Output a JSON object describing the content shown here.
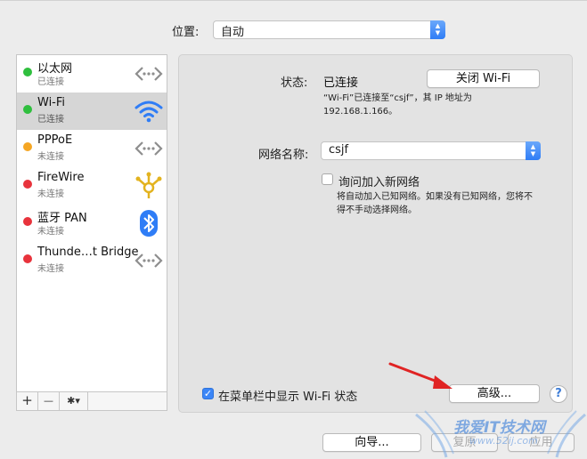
{
  "location": {
    "label": "位置:",
    "value": "自动"
  },
  "services": [
    {
      "name": "以太网",
      "status": "已连接",
      "dot_color": "#2fbf3e",
      "icon": "ethernet-icon"
    },
    {
      "name": "Wi-Fi",
      "status": "已连接",
      "dot_color": "#2fbf3e",
      "icon": "wifi-icon"
    },
    {
      "name": "PPPoE",
      "status": "未连接",
      "dot_color": "#f5a623",
      "icon": "pppoe-icon"
    },
    {
      "name": "FireWire",
      "status": "未连接",
      "dot_color": "#e8333c",
      "icon": "firewire-icon"
    },
    {
      "name": "蓝牙 PAN",
      "status": "未连接",
      "dot_color": "#e8333c",
      "icon": "bluetooth-icon"
    },
    {
      "name": "Thunde…t Bridge",
      "status": "未连接",
      "dot_color": "#e8333c",
      "icon": "thunderbolt-bridge-icon"
    }
  ],
  "selected_service": "Wi-Fi",
  "sidebar_footer": {
    "add": "+",
    "remove": "—",
    "action": "✱▾"
  },
  "detail": {
    "status_label": "状态:",
    "status_value": "已连接",
    "turn_off_button": "关闭 Wi-Fi",
    "status_desc_line1": "“Wi-Fi”已连接至“csjf”，其 IP 地址为",
    "status_desc_line2": "192.168.1.166。",
    "network_name_label": "网络名称:",
    "network_name_value": "csjf",
    "ask_join_label": "询问加入新网络",
    "ask_join_checked": false,
    "ask_join_desc_line1": "将自动加入已知网络。如果没有已知网络，您将不",
    "ask_join_desc_line2": "得不手动选择网络。",
    "show_menubar_label": "在菜单栏中显示 Wi-Fi 状态",
    "show_menubar_checked": true,
    "advanced_button": "高级...",
    "help_button": "?"
  },
  "bottom": {
    "assist_button": "向导...",
    "revert_button": "复原",
    "apply_button": "应用"
  },
  "watermark": {
    "text_cn": "我爱IT技术网",
    "text_url": "www.52ij.com"
  },
  "colors": {
    "accent": "#3b86f7",
    "annotation_arrow": "#e02424"
  }
}
